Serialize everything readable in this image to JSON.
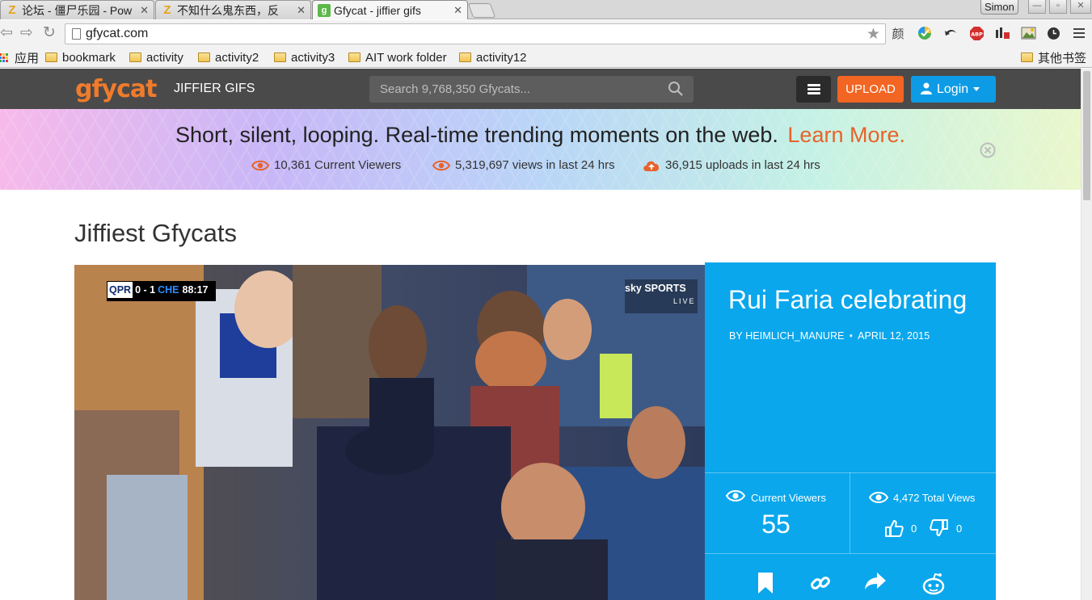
{
  "browser": {
    "tabs": [
      {
        "title": "论坛 - 僵尸乐园 - Pow",
        "favicon": "z-icon"
      },
      {
        "title": "不知什么鬼东西，反",
        "favicon": "z-icon"
      },
      {
        "title": "Gfycat - jiffier gifs",
        "favicon": "gfycat-icon"
      }
    ],
    "profile_name": "Simon",
    "url": "gfycat.com",
    "ext_text": "颜",
    "bookmarks": {
      "apps_label": "应用",
      "items": [
        "bookmark",
        "activity",
        "activity2",
        "activity3",
        "AIT work folder",
        "activity12"
      ],
      "other_label": "其他书签"
    }
  },
  "site": {
    "logo": "gfycat",
    "tagline": "JIFFIER GIFS",
    "search_placeholder": "Search 9,768,350 Gfycats...",
    "upload_label": "UPLOAD",
    "login_label": "Login"
  },
  "banner": {
    "headline": "Short, silent, looping. Real-time trending moments on the web.",
    "learn_more": "Learn More.",
    "stats": {
      "current_viewers": "10,361 Current Viewers",
      "views_24h": "5,319,697 views in last 24 hrs",
      "uploads_24h": "36,915 uploads in last 24 hrs"
    }
  },
  "main": {
    "section_title": "Jiffiest Gfycats",
    "video": {
      "scoreboard": {
        "home": "QPR",
        "score": "0 - 1",
        "away": "CHE",
        "clock": "88:17"
      },
      "broadcaster": "sky SPORTS",
      "broadcaster_sub": "LIVE"
    },
    "card": {
      "title": "Rui Faria celebrating",
      "author": "BY HEIMLICH_MANURE",
      "date": "APRIL 12, 2015",
      "current_viewers_label": "Current Viewers",
      "current_viewers": "55",
      "total_views": "4,472 Total Views",
      "likes": "0",
      "dislikes": "0"
    }
  },
  "colors": {
    "accent_orange": "#f26522",
    "accent_blue": "#0aa7ec",
    "header_bg": "#4a4a4a"
  }
}
